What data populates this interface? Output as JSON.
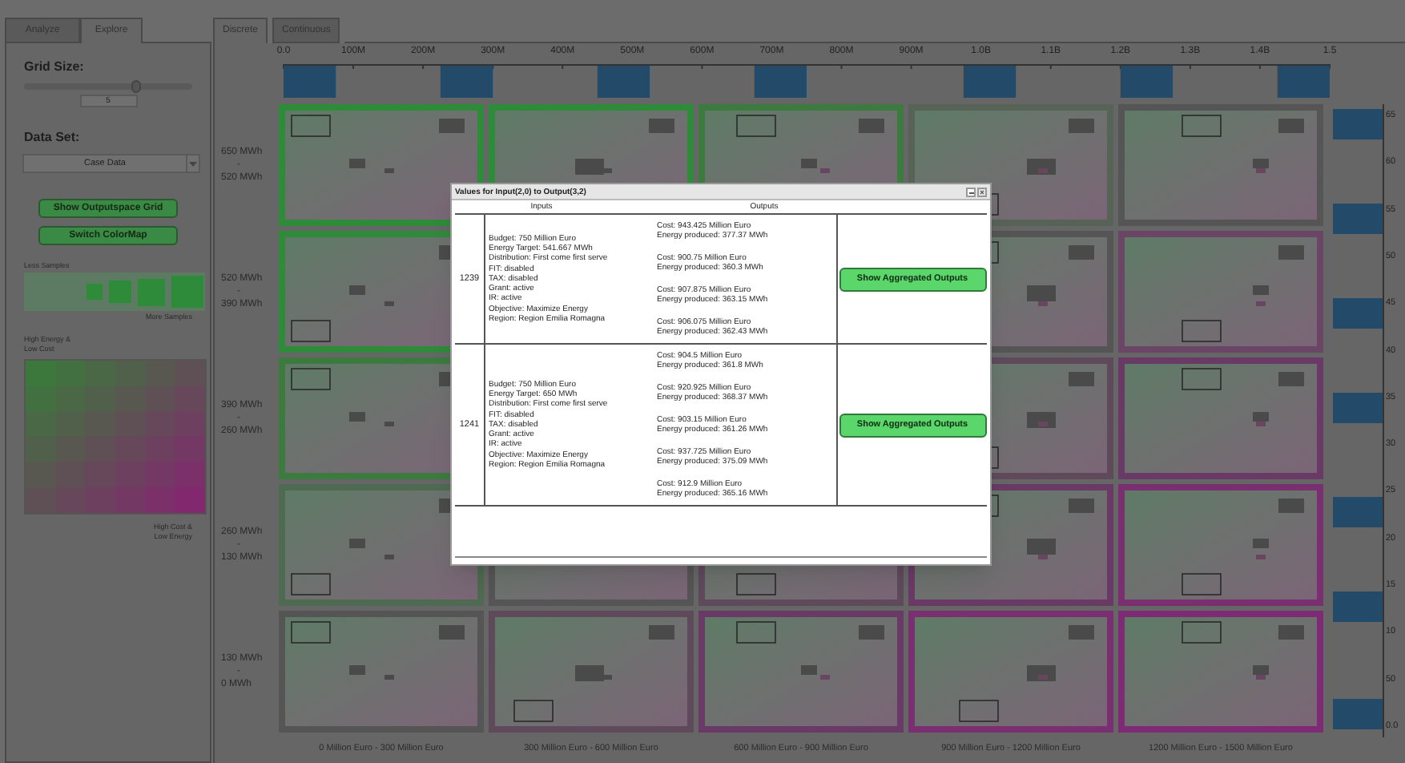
{
  "left_panel": {
    "tabs": [
      {
        "label": "Analyze",
        "selected": false
      },
      {
        "label": "Explore",
        "selected": true
      }
    ],
    "grid_size": {
      "label": "Grid Size:",
      "level": 0.67,
      "value": "5"
    },
    "data_set": {
      "label": "Data Set:",
      "value": "Case Data"
    },
    "buttons": [
      "Show Outputspace Grid",
      "Switch ColorMap"
    ],
    "size_legend": {
      "top_label": "Less Samples",
      "bottom_label": "More Samples"
    },
    "color_legend": {
      "top_label": [
        "High Energy &",
        "Low Cost"
      ],
      "bottom_label": [
        "High Cost &",
        "Low Energy"
      ]
    }
  },
  "main_panel": {
    "tabs": [
      {
        "label": "Discrete",
        "selected": true
      },
      {
        "label": "Continuous",
        "selected": false
      }
    ],
    "x_axis_ticks": [
      "0.0",
      "100M",
      "200M",
      "300M",
      "400M",
      "500M",
      "600M",
      "700M",
      "800M",
      "900M",
      "1.0B",
      "1.1B",
      "1.2B",
      "1.3B",
      "1.4B",
      "1.5"
    ],
    "rows": [
      {
        "range": [
          "650 MWh",
          "-",
          "520 MWh"
        ],
        "cells": [
          {
            "color": "#2e8b3a"
          },
          {
            "color": "#2e8b3a"
          },
          {
            "color": "#3c7a40"
          },
          {
            "color": "#566356"
          },
          {
            "color": "#555555"
          }
        ]
      },
      {
        "range": [
          "520 MWh",
          "-",
          "390 MWh"
        ],
        "cells": [
          {
            "color": "#2e8b3a"
          },
          null,
          null,
          {
            "color": "#555555"
          },
          {
            "color": "#6a4565"
          }
        ]
      },
      {
        "range": [
          "390 MWh",
          "-",
          "260 MWh"
        ],
        "cells": [
          {
            "color": "#3c7a40"
          },
          null,
          null,
          {
            "color": "#5f4a5c"
          },
          {
            "color": "#6a3a66"
          }
        ]
      },
      {
        "range": [
          "260 MWh",
          "-",
          "130 MWh"
        ],
        "cells": [
          {
            "color": "#4e6a50"
          },
          {
            "color": "#555555"
          },
          {
            "color": "#5f4a5c"
          },
          {
            "color": "#6a3a66"
          },
          {
            "color": "#7a2f70"
          }
        ]
      },
      {
        "range": [
          "130 MWh",
          "-",
          "0 MWh"
        ],
        "cells": [
          {
            "color": "#555555"
          },
          {
            "color": "#5f4a5c"
          },
          {
            "color": "#6a3a66"
          },
          {
            "color": "#7a2f70"
          },
          {
            "color": "#7f2a75"
          }
        ]
      }
    ],
    "column_labels": [
      "0 Million Euro - 300 Million Euro",
      "300 Million Euro - 600 Million Euro",
      "600 Million Euro - 900 Million Euro",
      "900 Million Euro - 1200 Million Euro",
      "1200 Million Euro - 1500 Million Euro"
    ],
    "right_axis_ticks": [
      "65",
      "60",
      "55",
      "50",
      "45",
      "40",
      "35",
      "30",
      "25",
      "20",
      "15",
      "10",
      "50",
      "0.0"
    ]
  },
  "dialog": {
    "title": "Values for Input(2,0) to Output(3,2)",
    "columns": [
      "Inputs",
      "Outputs"
    ],
    "rows": [
      {
        "id": "1239",
        "inputs": [
          "Budget: 750 Million Euro",
          "Energy Target: 541.667 MWh",
          "Distribution: First come first serve",
          "FIT: disabled",
          "TAX: disabled",
          "Grant: active",
          "IR: active",
          "Objective: Maximize Energy",
          "Region: Region Emilia Romagna"
        ],
        "outputs": [
          {
            "cost": "Cost: 943.425 Million Euro",
            "energy": "Energy produced: 377.37 MWh"
          },
          {
            "cost": "Cost: 900.75 Million Euro",
            "energy": "Energy produced: 360.3 MWh"
          },
          {
            "cost": "Cost: 907.875 Million Euro",
            "energy": "Energy produced: 363.15 MWh"
          },
          {
            "cost": "Cost: 906.075 Million Euro",
            "energy": "Energy produced: 362.43 MWh"
          }
        ],
        "button": "Show Aggregated Outputs"
      },
      {
        "id": "1241",
        "inputs": [
          "Budget: 750 Million Euro",
          "Energy Target: 650 MWh",
          "Distribution: First come first serve",
          "FIT: disabled",
          "TAX: disabled",
          "Grant: active",
          "IR: active",
          "Objective: Maximize Energy",
          "Region: Region Emilia Romagna"
        ],
        "outputs": [
          {
            "cost": "Cost: 904.5 Million Euro",
            "energy": "Energy produced: 361.8 MWh"
          },
          {
            "cost": "Cost: 920.925 Million Euro",
            "energy": "Energy produced: 368.37 MWh"
          },
          {
            "cost": "Cost: 903.15 Million Euro",
            "energy": "Energy produced: 361.26 MWh"
          },
          {
            "cost": "Cost: 937.725 Million Euro",
            "energy": "Energy produced: 375.09 MWh"
          },
          {
            "cost": "Cost: 912.9 Million Euro",
            "energy": "Energy produced: 365.16 MWh"
          }
        ],
        "button": "Show Aggregated Outputs"
      }
    ]
  }
}
